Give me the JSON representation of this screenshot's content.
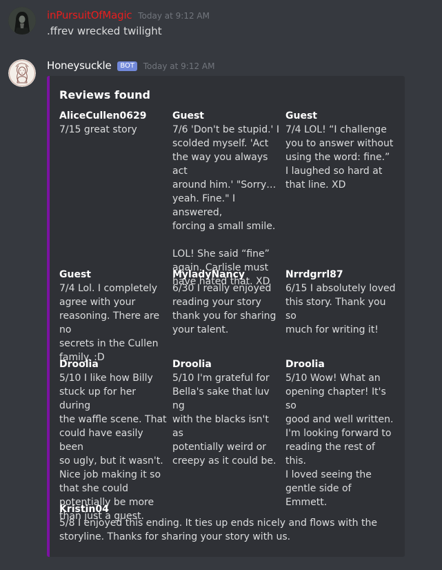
{
  "messages": [
    {
      "author": "inPursuitOfMagic",
      "author_color": "#e91e1e",
      "timestamp": "Today at 9:12 AM",
      "content": ".ffrev wrecked twilight",
      "avatar_icon": "hooded-figure-avatar"
    },
    {
      "author": "Honeysuckle",
      "author_color": "#ffffff",
      "badge": "BOT",
      "timestamp": "Today at 9:12 AM",
      "avatar_icon": "sketch-portrait-avatar",
      "embed": {
        "accent_color": "#7b12a1",
        "title": "Reviews found",
        "fields": [
          {
            "name": "AliceCullen0629",
            "value": "7/15 great story"
          },
          {
            "name": "Guest",
            "value": "7/6 'Don't be stupid.' I\nscolded myself. 'Act\nthe way you always act\naround him.' \"Sorry…\nyeah. Fine.\" I answered,\nforcing a small smile.\n\nLOL! She said “fine”\nagain. Carlisle must\nhave hated that. XD"
          },
          {
            "name": "Guest",
            "value": "7/4 LOL! “I challenge\nyou to answer without\nusing the word: fine.”\nI laughed so hard at\nthat line. XD"
          },
          {
            "name": "Guest",
            "value": "7/4 Lol. I completely\nagree with your\nreasoning. There are no\nsecrets in the Cullen\nfamily. :D"
          },
          {
            "name": "MyladyNancy",
            "value": "6/30 I really enjoyed\nreading your story\nthank you for sharing\nyour talent."
          },
          {
            "name": "Nrrdgrrl87",
            "value": "6/15 I absolutely loved\nthis story. Thank you so\nmuch for writing it!"
          },
          {
            "name": "Droolia",
            "value": "5/10 I like how Billy\nstuck up for her during\nthe waffle scene. That\ncould have easily been\nso ugly, but it wasn't.\nNice job making it so\nthat she could\npotentially be more\nthan just a guest."
          },
          {
            "name": "Droolia",
            "value": "5/10 I'm grateful for\nBella's sake that luv ng\nwith the blacks isn't as\npotentially weird or\ncreepy as it could be."
          },
          {
            "name": "Droolia",
            "value": "5/10 Wow! What an\nopening chapter! It's so\ngood and well written.\nI'm looking forward to\nreading the rest of this.\nI loved seeing the\ngentle side of Emmett."
          },
          {
            "name": "Kristin04",
            "value": "5/8 I enjoyed this ending. It ties up ends nicely and flows with the\nstoryline. Thanks for sharing your story with us."
          }
        ]
      }
    }
  ]
}
